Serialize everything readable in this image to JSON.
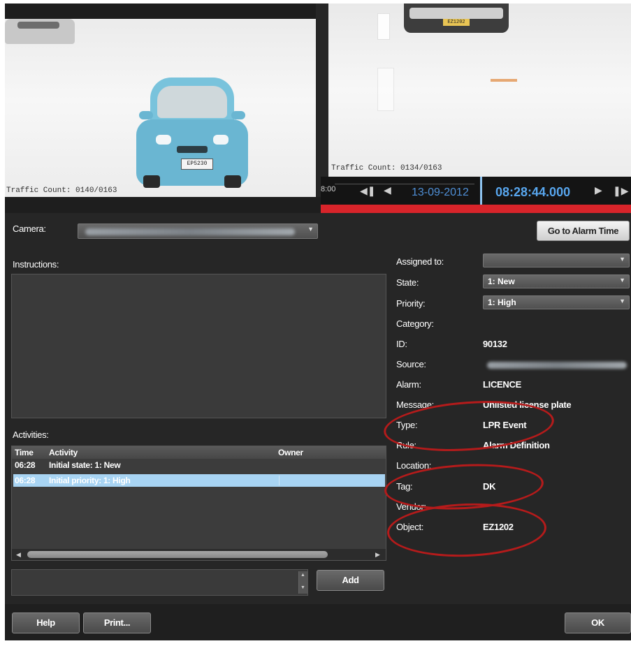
{
  "video": {
    "left_caption": "Traffic Count: 0140/0163",
    "right_caption": "Traffic Count: 0134/0163",
    "plate_left": "EP5230",
    "plate_right": "EZ1202"
  },
  "timeline": {
    "left_time_fragment": "8:00",
    "date": "13-09-2012",
    "time": "08:28:44.000",
    "icons": [
      "skip-back-icon",
      "play-reverse-icon",
      "play-icon",
      "skip-forward-icon"
    ]
  },
  "camera": {
    "label": "Camera:",
    "value": ""
  },
  "goto_alarm_label": "Go to Alarm Time",
  "instructions": {
    "label": "Instructions:",
    "text": ""
  },
  "activities": {
    "label": "Activities:",
    "columns": [
      "Time",
      "Activity",
      "Owner"
    ],
    "rows": [
      {
        "time": "06:28",
        "activity": "Initial state: 1: New",
        "owner": "",
        "selected": false
      },
      {
        "time": "06:28",
        "activity": "Initial priority: 1: High",
        "owner": "",
        "selected": true
      }
    ],
    "add_label": "Add",
    "input_value": ""
  },
  "details": {
    "assigned_to": {
      "label": "Assigned to:",
      "value": ""
    },
    "state": {
      "label": "State:",
      "value": "1: New"
    },
    "priority": {
      "label": "Priority:",
      "value": "1: High"
    },
    "category": {
      "label": "Category:",
      "value": ""
    },
    "id": {
      "label": "ID:",
      "value": "90132"
    },
    "source": {
      "label": "Source:",
      "value": ""
    },
    "alarm": {
      "label": "Alarm:",
      "value": "LICENCE"
    },
    "message": {
      "label": "Message:",
      "value": "Unlisted license plate"
    },
    "type": {
      "label": "Type:",
      "value": "LPR Event"
    },
    "rule": {
      "label": "Rule:",
      "value": "Alarm Definition"
    },
    "location": {
      "label": "Location:",
      "value": ""
    },
    "tag": {
      "label": "Tag:",
      "value": "DK"
    },
    "vendor": {
      "label": "Vendor:",
      "value": ""
    },
    "object": {
      "label": "Object:",
      "value": "EZ1202"
    }
  },
  "footer": {
    "help_label": "Help",
    "print_label": "Print...",
    "ok_label": "OK"
  },
  "colors": {
    "highlight_ring": "#b51b1b",
    "selection": "#a8d4f3",
    "timeline_red": "#d8242a",
    "time_blue": "#58a6ee"
  }
}
